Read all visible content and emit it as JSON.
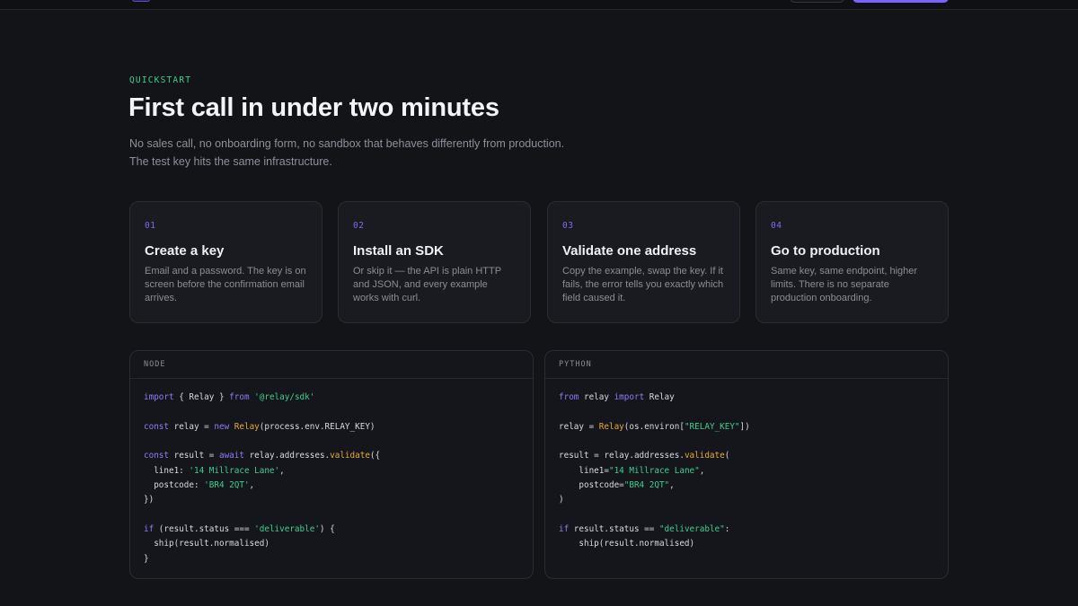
{
  "section": {
    "eyebrow": "QUICKSTART",
    "title": "First call in under two minutes",
    "subtitle_lines": [
      "No sales call, no onboarding form, no sandbox that behaves differently from production.",
      "The test key hits the same infrastructure."
    ]
  },
  "steps": [
    {
      "number": "01",
      "title": "Create a key",
      "description": "Email and a password. The key is on screen before the confirmation email arrives."
    },
    {
      "number": "02",
      "title": "Install an SDK",
      "description": "Or skip it — the API is plain HTTP and JSON, and every example works with curl."
    },
    {
      "number": "03",
      "title": "Validate one address",
      "description": "Copy the example, swap the key. If it fails, the error tells you exactly which field caused it."
    },
    {
      "number": "04",
      "title": "Go to production",
      "description": "Same key, same endpoint, higher limits. There is no separate production onboarding."
    }
  ],
  "code_samples": [
    {
      "language": "NODE",
      "lines": [
        [
          {
            "t": "import",
            "c": "kw"
          },
          {
            "t": " { Relay } ",
            "c": ""
          },
          {
            "t": "from",
            "c": "kw"
          },
          {
            "t": " ",
            "c": ""
          },
          {
            "t": "'@relay/sdk'",
            "c": "str"
          }
        ],
        [],
        [
          {
            "t": "const",
            "c": "kw"
          },
          {
            "t": " relay = ",
            "c": ""
          },
          {
            "t": "new",
            "c": "kw"
          },
          {
            "t": " ",
            "c": ""
          },
          {
            "t": "Relay",
            "c": "fn"
          },
          {
            "t": "(process.env.RELAY_KEY)",
            "c": ""
          }
        ],
        [],
        [
          {
            "t": "const",
            "c": "kw"
          },
          {
            "t": " result = ",
            "c": ""
          },
          {
            "t": "await",
            "c": "kw"
          },
          {
            "t": " relay.addresses.",
            "c": ""
          },
          {
            "t": "validate",
            "c": "fn"
          },
          {
            "t": "({",
            "c": ""
          }
        ],
        [
          {
            "t": "  line1: ",
            "c": ""
          },
          {
            "t": "'14 Millrace Lane'",
            "c": "str"
          },
          {
            "t": ",",
            "c": ""
          }
        ],
        [
          {
            "t": "  postcode: ",
            "c": ""
          },
          {
            "t": "'BR4 2QT'",
            "c": "str"
          },
          {
            "t": ",",
            "c": ""
          }
        ],
        [
          {
            "t": "})",
            "c": ""
          }
        ],
        [],
        [
          {
            "t": "if",
            "c": "kw"
          },
          {
            "t": " (result.status === ",
            "c": ""
          },
          {
            "t": "'deliverable'",
            "c": "str"
          },
          {
            "t": ") {",
            "c": ""
          }
        ],
        [
          {
            "t": "  ship(result.normalised)",
            "c": ""
          }
        ],
        [
          {
            "t": "}",
            "c": ""
          }
        ]
      ]
    },
    {
      "language": "PYTHON",
      "lines": [
        [
          {
            "t": "from",
            "c": "kw"
          },
          {
            "t": " relay ",
            "c": ""
          },
          {
            "t": "import",
            "c": "kw"
          },
          {
            "t": " Relay",
            "c": ""
          }
        ],
        [],
        [
          {
            "t": "relay = ",
            "c": ""
          },
          {
            "t": "Relay",
            "c": "fn"
          },
          {
            "t": "(os.environ[",
            "c": ""
          },
          {
            "t": "\"RELAY_KEY\"",
            "c": "str"
          },
          {
            "t": "])",
            "c": ""
          }
        ],
        [],
        [
          {
            "t": "result = relay.addresses.",
            "c": ""
          },
          {
            "t": "validate",
            "c": "fn"
          },
          {
            "t": "(",
            "c": ""
          }
        ],
        [
          {
            "t": "    line1=",
            "c": ""
          },
          {
            "t": "\"14 Millrace Lane\"",
            "c": "str"
          },
          {
            "t": ",",
            "c": ""
          }
        ],
        [
          {
            "t": "    postcode=",
            "c": ""
          },
          {
            "t": "\"BR4 2QT\"",
            "c": "str"
          },
          {
            "t": ",",
            "c": ""
          }
        ],
        [
          {
            "t": ")",
            "c": ""
          }
        ],
        [],
        [
          {
            "t": "if",
            "c": "kw"
          },
          {
            "t": " result.status == ",
            "c": ""
          },
          {
            "t": "\"deliverable\"",
            "c": "str"
          },
          {
            "t": ":",
            "c": ""
          }
        ],
        [
          {
            "t": "    ship(result.normalised)",
            "c": ""
          }
        ]
      ]
    }
  ],
  "colors": {
    "background": "#131418",
    "accent_green": "#3ecf8e",
    "accent_purple": "#7b61ff",
    "keyword": "#8d7cf5",
    "function": "#e6a93b"
  }
}
